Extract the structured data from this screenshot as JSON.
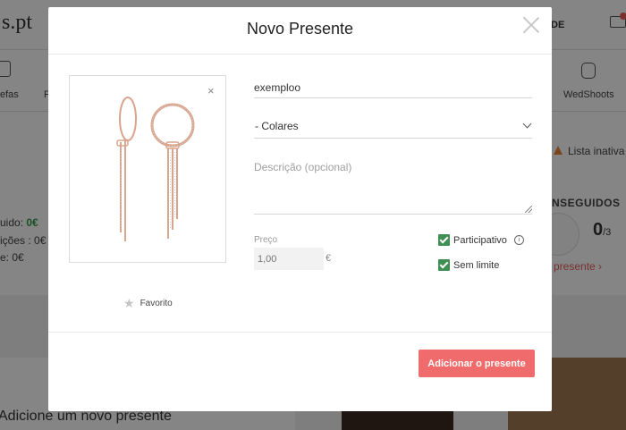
{
  "background": {
    "logo": "s.pt",
    "top_right_label": "DE",
    "nav": {
      "left1": "efas",
      "left2": "F",
      "right": "WedShoots"
    },
    "side_lines": [
      {
        "label": "uido: ",
        "value": "0€"
      },
      {
        "label": "ições : ",
        "value": "0€"
      },
      {
        "label": "e: ",
        "value": "0€"
      }
    ],
    "list_status": "Lista inativa",
    "seguidos_label": "NSEGUIDOS",
    "count_main": "0",
    "count_sub": "/3",
    "presente_link": "presente ›",
    "add_gift_title": "Adicione um novo presente"
  },
  "modal": {
    "title": "Novo Presente",
    "name_value": "exemploo",
    "category_selected": "- Colares",
    "description_placeholder": "Descrição (opcional)",
    "price_label": "Preço",
    "price_placeholder": "1,00",
    "currency": "€",
    "favorite_label": "Favorito",
    "options": {
      "participativo": "Participativo",
      "sem_limite": "Sem limite"
    },
    "add_button": "Adicionar o presente",
    "image_remove": "×"
  },
  "colors": {
    "accent": "#f06b6b",
    "checkbox": "#3f8e53",
    "earring_rose_gold": "#d9a58d"
  },
  "icons": {
    "close": "close-icon",
    "star": "star-icon",
    "info": "info-icon",
    "chevron": "chevron-down-icon"
  }
}
